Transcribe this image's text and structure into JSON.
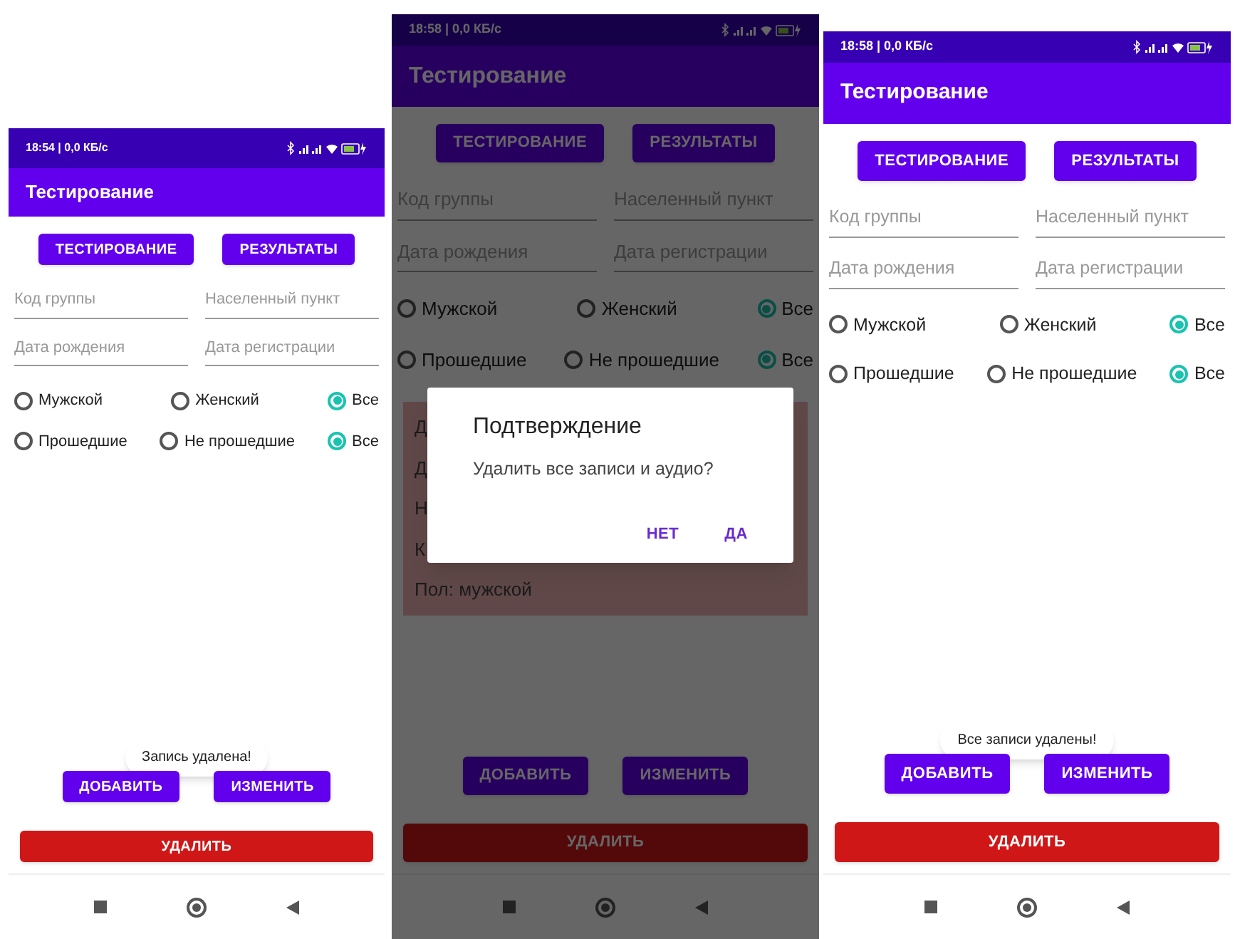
{
  "screens": [
    {
      "status_bar": {
        "time": "18:54 | 0,0 КБ/с"
      },
      "app_bar": {
        "title": "Тестирование"
      },
      "tabs": [
        {
          "label": "ТЕСТИРОВАНИЕ"
        },
        {
          "label": "РЕЗУЛЬТАТЫ"
        }
      ],
      "fields": [
        {
          "placeholder": "Код группы"
        },
        {
          "placeholder": "Населенный пункт"
        },
        {
          "placeholder": "Дата рождения"
        },
        {
          "placeholder": "Дата регистрации"
        }
      ],
      "radio_groups": [
        [
          {
            "label": "Мужской",
            "selected": false
          },
          {
            "label": "Женский",
            "selected": false
          },
          {
            "label": "Все",
            "selected": true
          }
        ],
        [
          {
            "label": "Прошедшие",
            "selected": false
          },
          {
            "label": "Не прошедшие",
            "selected": false
          },
          {
            "label": "Все",
            "selected": true
          }
        ]
      ],
      "toast": "Запись удалена!",
      "buttons": [
        {
          "label": "ДОБАВИТЬ"
        },
        {
          "label": "ИЗМЕНИТЬ"
        }
      ],
      "delete_button": "УДАЛИТЬ"
    },
    {
      "status_bar": {
        "time": "18:58 | 0,0 КБ/с"
      },
      "app_bar": {
        "title": "Тестирование"
      },
      "dimmed": true,
      "tabs": [
        {
          "label": "ТЕСТИРОВАНИЕ"
        },
        {
          "label": "РЕЗУЛЬТАТЫ"
        }
      ],
      "fields": [
        {
          "placeholder": "Код группы"
        },
        {
          "placeholder": "Населенный пункт"
        },
        {
          "placeholder": "Дата рождения"
        },
        {
          "placeholder": "Дата регистрации"
        }
      ],
      "radio_groups": [
        [
          {
            "label": "Мужской",
            "selected": false
          },
          {
            "label": "Женский",
            "selected": false
          },
          {
            "label": "Все",
            "selected": true
          }
        ],
        [
          {
            "label": "Прошедшие",
            "selected": false
          },
          {
            "label": "Не прошедшие",
            "selected": false
          },
          {
            "label": "Все",
            "selected": true
          }
        ]
      ],
      "record_card": [
        "Д",
        "Д",
        "Н",
        "К",
        "Пол: мужской"
      ],
      "dialog": {
        "title": "Подтверждение",
        "message": "Удалить все записи и аудио?",
        "actions": [
          "НЕТ",
          "ДА"
        ]
      },
      "buttons": [
        {
          "label": "ДОБАВИТЬ"
        },
        {
          "label": "ИЗМЕНИТЬ"
        }
      ],
      "delete_button": "УДАЛИТЬ"
    },
    {
      "status_bar": {
        "time": "18:58 | 0,0 КБ/с"
      },
      "app_bar": {
        "title": "Тестирование"
      },
      "tabs": [
        {
          "label": "ТЕСТИРОВАНИЕ"
        },
        {
          "label": "РЕЗУЛЬТАТЫ"
        }
      ],
      "fields": [
        {
          "placeholder": "Код группы"
        },
        {
          "placeholder": "Населенный пункт"
        },
        {
          "placeholder": "Дата рождения"
        },
        {
          "placeholder": "Дата регистрации"
        }
      ],
      "radio_groups": [
        [
          {
            "label": "Мужской",
            "selected": false
          },
          {
            "label": "Женский",
            "selected": false
          },
          {
            "label": "Все",
            "selected": true
          }
        ],
        [
          {
            "label": "Прошедшие",
            "selected": false
          },
          {
            "label": "Не прошедшие",
            "selected": false
          },
          {
            "label": "Все",
            "selected": true
          }
        ]
      ],
      "toast": "Все записи удалены!",
      "buttons": [
        {
          "label": "ДОБАВИТЬ"
        },
        {
          "label": "ИЗМЕНИТЬ"
        }
      ],
      "delete_button": "УДАЛИТЬ"
    }
  ]
}
